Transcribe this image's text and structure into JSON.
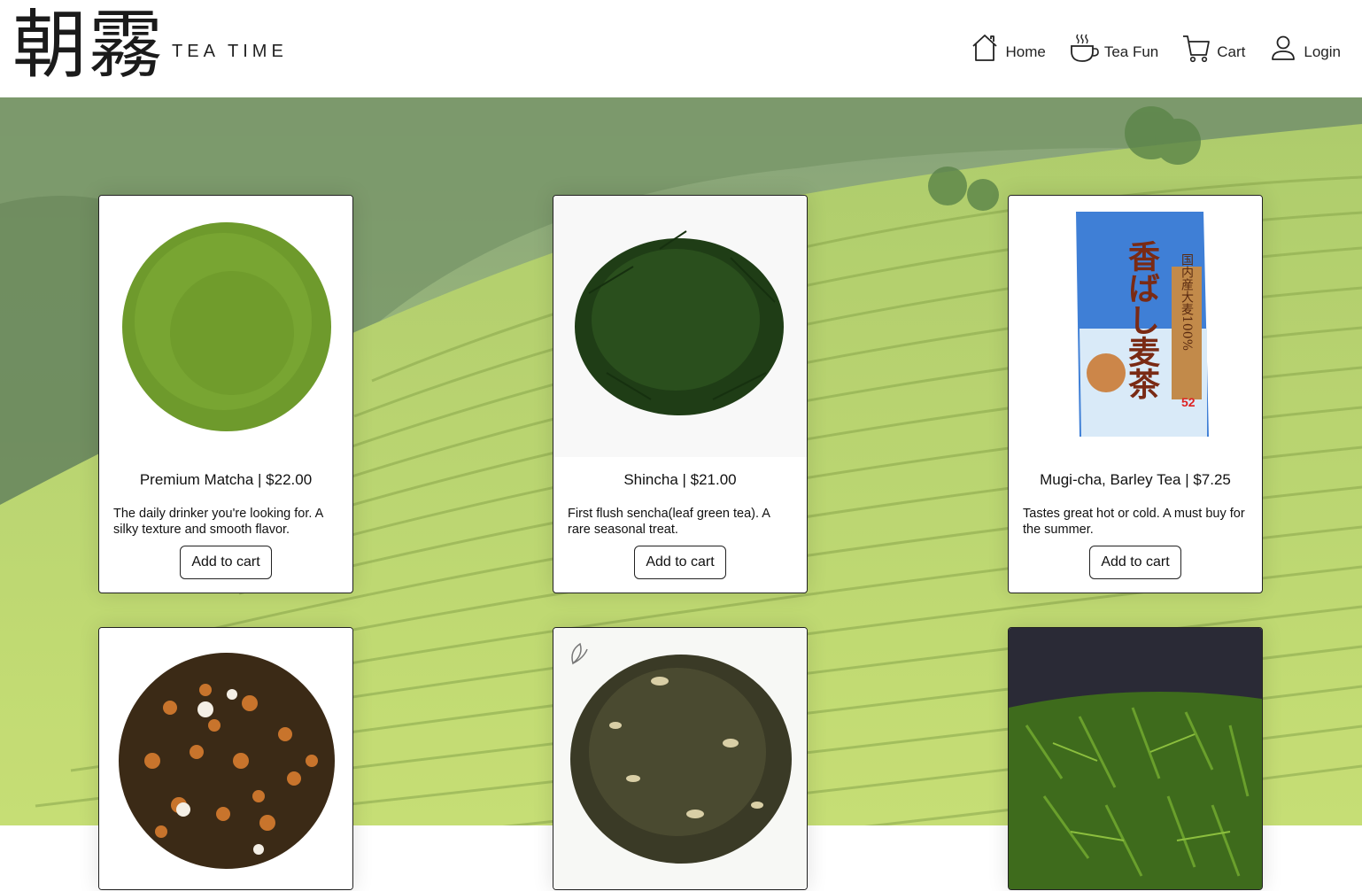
{
  "brand": {
    "kanji": "朝霧",
    "name": "TEA TIME"
  },
  "nav": [
    {
      "label": "Home",
      "icon": "home-icon"
    },
    {
      "label": "Tea Fun",
      "icon": "tea-cup-icon"
    },
    {
      "label": "Cart",
      "icon": "cart-icon"
    },
    {
      "label": "Login",
      "icon": "user-icon"
    }
  ],
  "products": [
    {
      "title": "Premium Matcha | $22.00",
      "description": "The daily drinker you're looking for. A silky texture and smooth flavor.",
      "button": "Add to cart",
      "image": "matcha-powder"
    },
    {
      "title": "Shincha | $21.00",
      "description": "First flush sencha(leaf green tea). A rare seasonal treat.",
      "button": "Add to cart",
      "image": "sencha-leaves"
    },
    {
      "title": "Mugi-cha, Barley Tea | $7.25",
      "description": "Tastes great hot or cold. A must buy for the summer.",
      "button": "Add to cart",
      "image": "barley-tea-package"
    },
    {
      "image": "genmaicha-leaves"
    },
    {
      "image": "jasmine-tea-leaves"
    },
    {
      "image": "green-tea-leaves-closeup"
    }
  ],
  "package_text": {
    "main": "香ばし麦茶",
    "side": "国内産大麦100%",
    "count": "52"
  },
  "colors": {
    "accent": "#7aa83a",
    "border": "#222222"
  }
}
